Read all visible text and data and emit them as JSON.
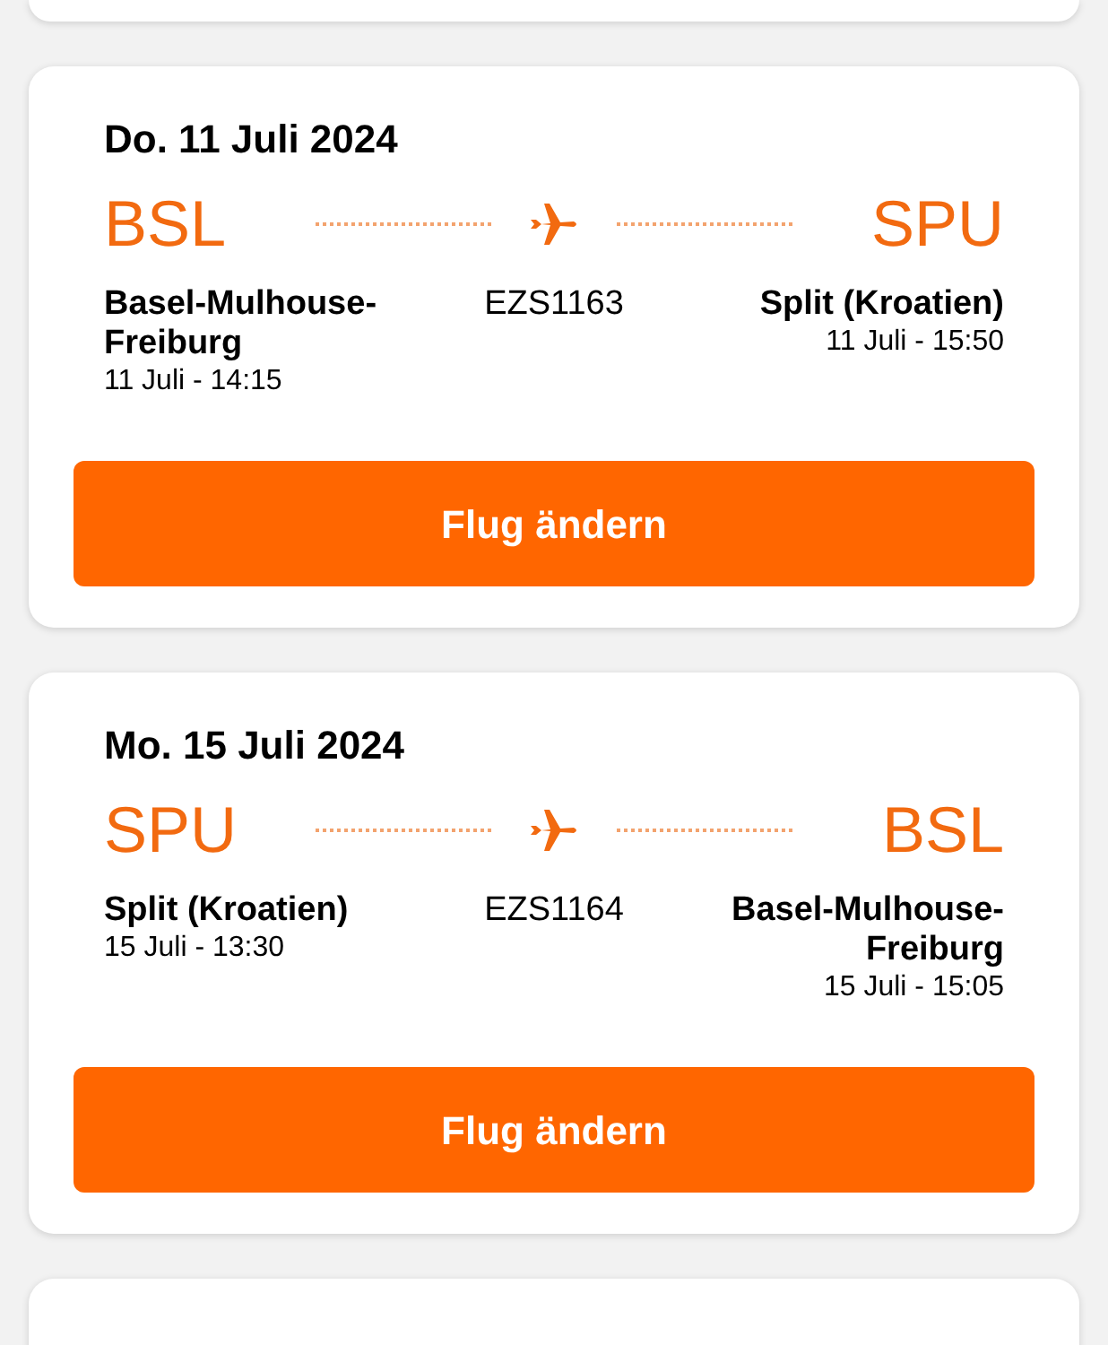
{
  "flights": [
    {
      "date": "Do. 11 Juli 2024",
      "origin": {
        "code": "BSL",
        "name": "Basel-Mulhouse-Freiburg",
        "time": "11 Juli - 14:15"
      },
      "flight_number": "EZS1163",
      "destination": {
        "code": "SPU",
        "name": "Split (Kroatien)",
        "time": "11 Juli - 15:50"
      },
      "button": "Flug ändern"
    },
    {
      "date": "Mo. 15 Juli 2024",
      "origin": {
        "code": "SPU",
        "name": "Split (Kroatien)",
        "time": "15 Juli - 13:30"
      },
      "flight_number": "EZS1164",
      "destination": {
        "code": "BSL",
        "name": "Basel-Mulhouse-Freiburg",
        "time": "15 Juli - 15:05"
      },
      "button": "Flug ändern"
    }
  ]
}
